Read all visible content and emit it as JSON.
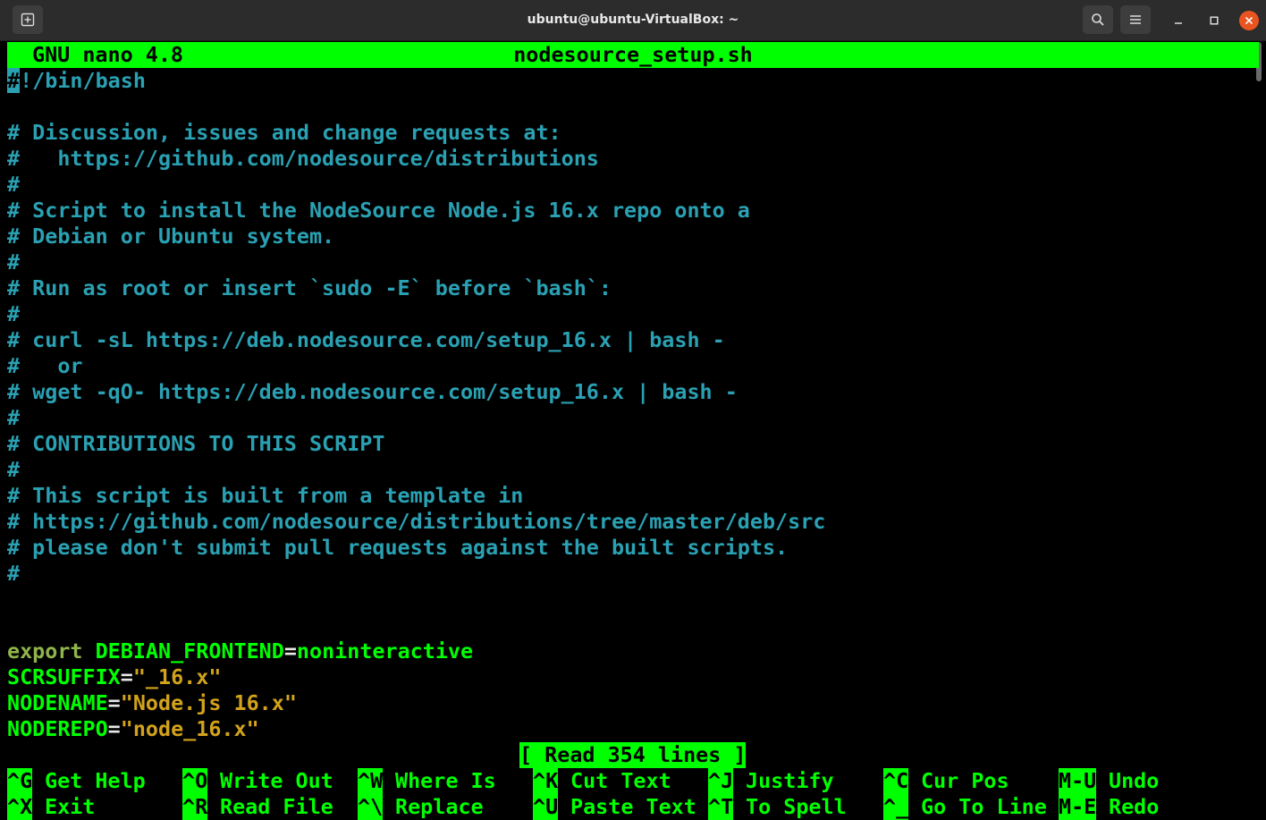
{
  "window": {
    "title": "ubuntu@ubuntu-VirtualBox: ~",
    "accent_close": "#e95420"
  },
  "nano": {
    "version_label": "GNU nano 4.8",
    "filename": "nodesource_setup.sh",
    "status_message": "[ Read 354 lines ]",
    "colors": {
      "bar": "#00ff00",
      "comment": "#2aa1b3",
      "keyword": "#8fb44a",
      "string": "#d2a21b"
    }
  },
  "file_lines": {
    "l1_cursor": "#",
    "l1_rest": "!/bin/bash",
    "l3": "# Discussion, issues and change requests at:",
    "l4": "#   https://github.com/nodesource/distributions",
    "l5": "#",
    "l6": "# Script to install the NodeSource Node.js 16.x repo onto a",
    "l7": "# Debian or Ubuntu system.",
    "l8": "#",
    "l9": "# Run as root or insert `sudo -E` before `bash`:",
    "l10": "#",
    "l11": "# curl -sL https://deb.nodesource.com/setup_16.x | bash -",
    "l12": "#   or",
    "l13": "# wget -qO- https://deb.nodesource.com/setup_16.x | bash -",
    "l14": "#",
    "l15": "# CONTRIBUTIONS TO THIS SCRIPT",
    "l16": "#",
    "l17": "# This script is built from a template in",
    "l18": "# https://github.com/nodesource/distributions/tree/master/deb/src",
    "l19": "# please don't submit pull requests against the built scripts.",
    "l20": "#",
    "l23_keyword": "export",
    "l23_var": " DEBIAN_FRONTEND",
    "l23_eq": "=",
    "l23_value": "noninteractive",
    "l24_var": "SCRSUFFIX",
    "l24_eq": "=",
    "l24_value": "\"_16.x\"",
    "l25_var": "NODENAME",
    "l25_eq": "=",
    "l25_value": "\"Node.js 16.x\"",
    "l26_var": "NODEREPO",
    "l26_eq": "=",
    "l26_value": "\"node_16.x\""
  },
  "shortcuts": [
    {
      "key": "^G",
      "label": "Get Help"
    },
    {
      "key": "^O",
      "label": "Write Out"
    },
    {
      "key": "^W",
      "label": "Where Is"
    },
    {
      "key": "^K",
      "label": "Cut Text"
    },
    {
      "key": "^J",
      "label": "Justify"
    },
    {
      "key": "^C",
      "label": "Cur Pos"
    },
    {
      "key": "M-U",
      "label": "Undo"
    },
    {
      "key": "^X",
      "label": "Exit"
    },
    {
      "key": "^R",
      "label": "Read File"
    },
    {
      "key": "^\\",
      "label": "Replace"
    },
    {
      "key": "^U",
      "label": "Paste Text"
    },
    {
      "key": "^T",
      "label": "To Spell"
    },
    {
      "key": "^_",
      "label": "Go To Line"
    },
    {
      "key": "M-E",
      "label": "Redo"
    }
  ],
  "icons": {
    "new_tab": "new-tab-icon",
    "search": "search-icon",
    "menu": "hamburger-menu-icon",
    "minimize": "minimize-icon",
    "maximize": "maximize-icon",
    "close": "close-icon"
  }
}
